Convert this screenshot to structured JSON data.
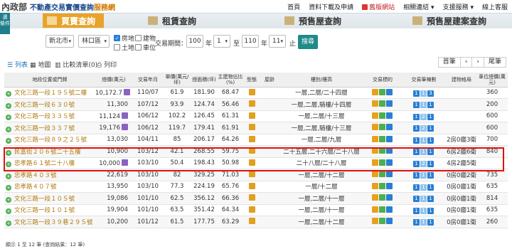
{
  "header": {
    "logo_mark": "內政部",
    "logo_title": "不動產交易實價查詢",
    "logo_service": "服務網",
    "nav": [
      "首頁",
      "資料下載及申請",
      "舊版網站",
      "相關連結",
      "支援服務",
      "線上客服"
    ]
  },
  "side_button": "選\n條件",
  "tabs": [
    "買賣查詢",
    "租賃查詢",
    "預售屋查詢",
    "預售屋建案查詢"
  ],
  "search": {
    "city": "新北市",
    "district": "林口區",
    "checks": [
      {
        "label": "房地",
        "checked": true
      },
      {
        "label": "建物",
        "checked": false
      },
      {
        "label": "土地",
        "checked": false
      },
      {
        "label": "車位",
        "checked": false
      }
    ],
    "period_label": "交易期間：",
    "from_year": "100",
    "year_label": "年",
    "from_month": "1",
    "to_label": "至",
    "to_year": "110",
    "to_month": "11",
    "end_label": "止",
    "button": "搜尋"
  },
  "views": [
    "列表",
    "地圖",
    "比較清單(0)",
    "列印"
  ],
  "pager": [
    "首筆",
    "‹",
    "›",
    "尾筆"
  ],
  "table": {
    "headers": [
      "地段位置或門牌",
      "總價(萬元)",
      "交易年月",
      "單價(萬元/坪)",
      "總面積(坪)",
      "主建物佔比(%)",
      "型態",
      "屋齡",
      "樓別/樓高",
      "交易標的",
      "交易筆棟數",
      "建物格局",
      "車位總價(萬元)"
    ],
    "rows": [
      {
        "addr": "文化三路一段１９５號二樓",
        "price": "10,172.7",
        "date": "110/07",
        "unit": "61.9",
        "area": "181.90",
        "ratio": "68.47",
        "floor": "一層,二層/二十四層",
        "counts": [
          "1",
          "1",
          "3"
        ],
        "layout": "",
        "park": "360"
      },
      {
        "addr": "文化三路一段６３０號",
        "price": "11,300",
        "date": "107/12",
        "unit": "93.9",
        "area": "124.74",
        "ratio": "56.46",
        "floor": "一層,二層,騎樓/十四層",
        "counts": [
          "1",
          "1",
          "1"
        ],
        "layout": "",
        "park": "200"
      },
      {
        "addr": "文化三路一段３３５號",
        "price": "11,124",
        "date": "106/12",
        "unit": "102.2",
        "area": "126.45",
        "ratio": "61.31",
        "floor": "一層,二層/十三層",
        "counts": [
          "1",
          "2",
          "1"
        ],
        "layout": "",
        "park": "600"
      },
      {
        "addr": "文化三路一段３３７號",
        "price": "19,176",
        "date": "106/12",
        "unit": "119.7",
        "area": "179.41",
        "ratio": "61.91",
        "floor": "一層,二層,騎樓/十三層",
        "counts": [
          "1",
          "2",
          "1"
        ],
        "layout": "",
        "park": "600"
      },
      {
        "addr": "文化三路一段８９之２５號",
        "price": "13,030",
        "date": "104/11",
        "unit": "85",
        "area": "206.17",
        "ratio": "64.26",
        "floor": "一層,二層/九層",
        "counts": [
          "1",
          "1",
          "1"
        ],
        "layout": "2房0廳3衛",
        "park": "700"
      },
      {
        "addr": "民富街２０６號二十五樓",
        "price": "10,900",
        "date": "103/12",
        "unit": "42.1",
        "area": "268.55",
        "ratio": "59.75",
        "floor": "二十五層,二十六層/二十八層",
        "counts": [
          "1",
          "1",
          "1"
        ],
        "layout": "6房2廳6衛",
        "park": "840"
      },
      {
        "addr": "忠孝路６１號二十八樓",
        "price": "10,000",
        "date": "103/10",
        "unit": "50.4",
        "area": "198.43",
        "ratio": "50.98",
        "floor": "二十八層/二十八層",
        "counts": [
          "1",
          "2",
          "1"
        ],
        "layout": "4房2廳5衛",
        "park": ""
      },
      {
        "addr": "忠孝路４０３號",
        "price": "22,619",
        "date": "103/10",
        "unit": "82",
        "area": "329.25",
        "ratio": "71.03",
        "floor": "一層,二層/十二層",
        "counts": [
          "1",
          "1",
          "1"
        ],
        "layout": "0房0廳2衛",
        "park": "735"
      },
      {
        "addr": "忠孝路４０７號",
        "price": "13,950",
        "date": "103/10",
        "unit": "77.3",
        "area": "224.19",
        "ratio": "65.76",
        "floor": "一層/十二層",
        "counts": [
          "1",
          "1",
          "1"
        ],
        "layout": "0房0廳1衛",
        "park": "635"
      },
      {
        "addr": "文化三路一段１０５號",
        "price": "19,086",
        "date": "101/10",
        "unit": "62.5",
        "area": "356.12",
        "ratio": "66.36",
        "floor": "一層,二層/十一層",
        "counts": [
          "1",
          "1",
          "1"
        ],
        "layout": "0房0廳1衛",
        "park": "814"
      },
      {
        "addr": "文化三路一段１０１號",
        "price": "19,904",
        "date": "101/10",
        "unit": "63.5",
        "area": "351.42",
        "ratio": "64.34",
        "floor": "一層,二層/十一層",
        "counts": [
          "1",
          "1",
          "1"
        ],
        "layout": "0房0廳1衛",
        "park": "635"
      },
      {
        "addr": "文化三路一段３９巷２９５號",
        "price": "10,200",
        "date": "101/12",
        "unit": "61.5",
        "area": "177.75",
        "ratio": "63.29",
        "floor": "一層,二層/十二層",
        "counts": [
          "1",
          "1",
          "1"
        ],
        "layout": "0房0廳1衛",
        "park": "260"
      }
    ]
  },
  "footer": "顯示 1 至 12 筆 (查詢結果：12 筆)"
}
